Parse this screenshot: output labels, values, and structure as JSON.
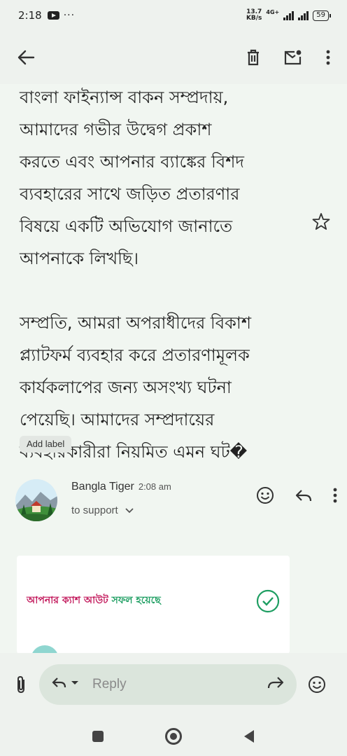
{
  "status_bar": {
    "time": "2:18",
    "speed_value": "13.7",
    "speed_unit": "KB/s",
    "network": "4G+",
    "battery": "59"
  },
  "toolbar": {
    "back_icon": "arrow-back-icon",
    "delete_icon": "trash-icon",
    "mark_unread_icon": "mail-unread-icon",
    "more_icon": "more-vert-icon"
  },
  "message": {
    "body": "বাংলা ফাইন্যান্স বাকন সম্প্রদায়,\nআমাদের গভীর উদ্বেগ প্রকাশ\nকরতে এবং আপনার ব্যাঙ্কের বিশদ\nব্যবহারের সাথে জড়িত প্রতারণার\nবিষয়ে একটি অভিযোগ জানাতে\nআপনাকে লিখছি।\n\nসম্প্রতি, আমরা অপরাধীদের বিকাশ\nপ্ল্যাটফর্ম ব্যবহার করে প্রতারণামূলক\nকার্যকলাপের জন্য অসংখ্য ঘটনা\nপেয়েছি। আমাদের সম্প্রদায়ের\nব্যবহারকারীরা নিয়মিত এমন ঘট�",
    "add_label": "Add label"
  },
  "reply_message": {
    "sender": "Bangla Tiger",
    "time": "2:08 am",
    "to": "to support",
    "card_text_1": "আপনার",
    "card_text_2": "ক্যাশ আউট",
    "card_text_3": "সফল হয়েছে"
  },
  "reply_bar": {
    "placeholder": "Reply"
  },
  "colors": {
    "accent_pink": "#c2185b",
    "accent_green": "#1e9e62",
    "background": "#f1f6f1"
  }
}
